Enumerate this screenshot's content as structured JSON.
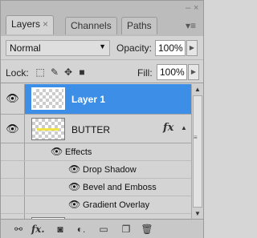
{
  "window": {
    "minimize": "–",
    "close": "×"
  },
  "tabs": [
    {
      "label": "Layers",
      "close": "×",
      "active": true
    },
    {
      "label": "Channels",
      "active": false
    },
    {
      "label": "Paths",
      "active": false
    }
  ],
  "panel_menu_icon": "panel-menu-icon",
  "blend_mode": {
    "value": "Normal"
  },
  "opacity": {
    "label": "Opacity:",
    "value": "100%"
  },
  "lock": {
    "label": "Lock:"
  },
  "fill": {
    "label": "Fill:",
    "value": "100%"
  },
  "layers": [
    {
      "name": "Layer 1",
      "selected": true,
      "visible": true
    },
    {
      "name": "BUTTER",
      "selected": false,
      "visible": true,
      "fx": "fx",
      "effects_label": "Effects",
      "effects": [
        "Drop Shadow",
        "Bevel and Emboss",
        "Gradient Overlay"
      ]
    }
  ],
  "bottom_toolbar": [
    "link-layers-icon",
    "add-layer-style-icon",
    "add-mask-icon",
    "adjustment-layer-icon",
    "new-group-icon",
    "new-layer-icon",
    "delete-layer-icon"
  ],
  "colors": {
    "selection": "#3d8ee6",
    "panel": "#d4d4d4",
    "butter_thumb_stripe": "#f1e34a"
  }
}
